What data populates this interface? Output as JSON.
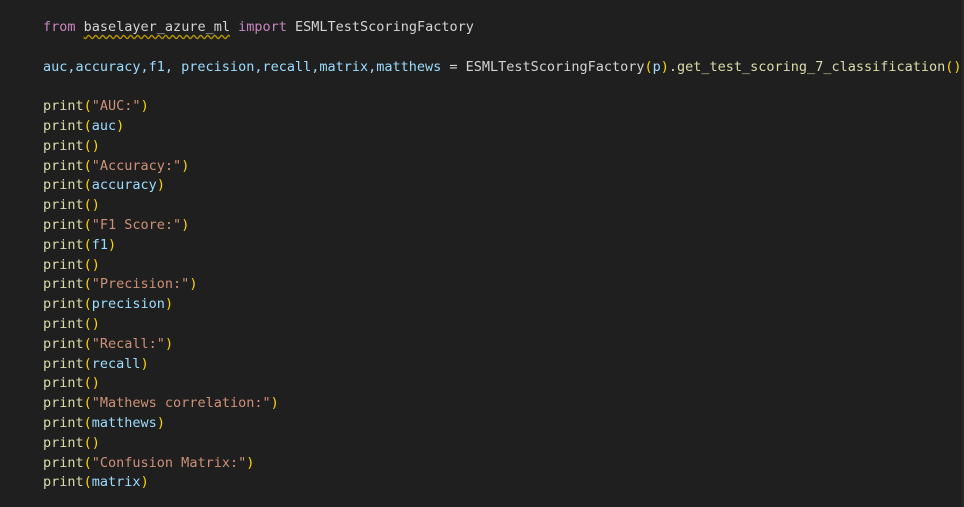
{
  "code": {
    "line1": {
      "kw_from": "from",
      "module": "baselayer_azure_ml",
      "kw_import": "import",
      "cls": "ESMLTestScoringFactory"
    },
    "line3": {
      "targets": "auc,accuracy,f1, precision,recall,matrix,matthews",
      "eq": " = ",
      "cls": "ESMLTestScoringFactory",
      "arg": "p",
      "method": ".get_test_scoring_7_classification"
    },
    "prints": [
      {
        "arg": "\"AUC:\"",
        "type": "str"
      },
      {
        "arg": "auc",
        "type": "var"
      },
      {
        "arg": "",
        "type": "empty"
      },
      {
        "arg": "\"Accuracy:\"",
        "type": "str"
      },
      {
        "arg": "accuracy",
        "type": "var"
      },
      {
        "arg": "",
        "type": "empty"
      },
      {
        "arg": "\"F1 Score:\"",
        "type": "str"
      },
      {
        "arg": "f1",
        "type": "var"
      },
      {
        "arg": "",
        "type": "empty"
      },
      {
        "arg": "\"Precision:\"",
        "type": "str"
      },
      {
        "arg": "precision",
        "type": "var"
      },
      {
        "arg": "",
        "type": "empty"
      },
      {
        "arg": "\"Recall:\"",
        "type": "str"
      },
      {
        "arg": "recall",
        "type": "var"
      },
      {
        "arg": "",
        "type": "empty"
      },
      {
        "arg": "\"Mathews correlation:\"",
        "type": "str"
      },
      {
        "arg": "matthews",
        "type": "var"
      },
      {
        "arg": "",
        "type": "empty"
      },
      {
        "arg": "\"Confusion Matrix:\"",
        "type": "str"
      },
      {
        "arg": "matrix",
        "type": "var"
      }
    ],
    "print_fn": "print"
  }
}
